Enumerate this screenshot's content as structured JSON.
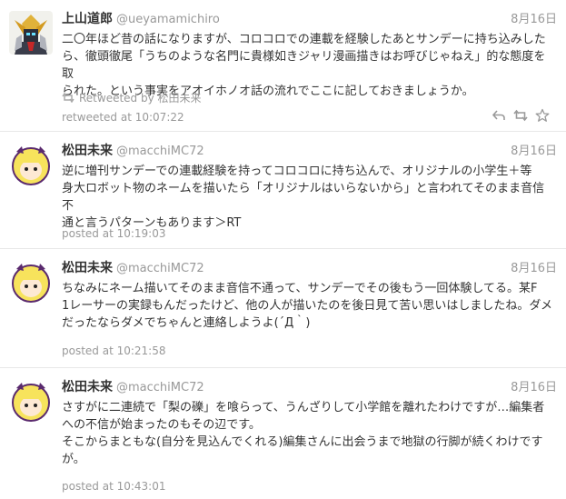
{
  "tweets": [
    {
      "name": "上山道郎",
      "screen_name": "@ueyamamichiro",
      "date": "8月16日",
      "text_lines": [
        "二〇年ほど昔の話になりますが、コロコロでの連載を経験したあとサンデーに持ち込みした",
        "ら、徹頭徹尾「うちのような名門に貴様如きジャリ漫画描きはお呼びじゃねえ」的な態度を取",
        "られた。という事実をアオイホノオ話の流れでここに記しておきましょうか。"
      ],
      "retweet_label": "Retweeted by",
      "retweeted_by": "松田未来",
      "stamp": "retweeted at 10:07:22"
    },
    {
      "name": "松田未来",
      "screen_name": "@macchiMC72",
      "date": "8月16日",
      "text_lines": [
        "逆に増刊サンデーでの連載経験を持ってコロコロに持ち込んで、オリジナルの小学生＋等",
        "身大ロボット物のネームを描いたら「オリジナルはいらないから」と言われてそのまま音信不",
        "通と言うパターンもあります＞RT"
      ],
      "stamp": "posted at 10:19:03"
    },
    {
      "name": "松田未来",
      "screen_name": "@macchiMC72",
      "date": "8月16日",
      "text_lines": [
        "ちなみにネーム描いてそのまま音信不通って、サンデーでその後もう一回体験してる。某F",
        "1レーサーの実録もんだったけど、他の人が描いたのを後日見て苦い思いはしましたね。ダメ",
        "だったならダメでちゃんと連絡しようよ(´Д｀)"
      ],
      "stamp": "posted at 10:21:58"
    },
    {
      "name": "松田未来",
      "screen_name": "@macchiMC72",
      "date": "8月16日",
      "text_lines": [
        "さすがに二連続で「梨の礫」を喰らって、うんざりして小学館を離れたわけですが…編集者",
        "への不信が始まったのもその辺です。",
        "そこからまともな(自分を見込んでくれる)編集さんに出会うまで地獄の行脚が続くわけです",
        "が。"
      ],
      "stamp": "posted at 10:43:01"
    }
  ],
  "icons": {
    "reply": "reply-icon",
    "retweet": "retweet-icon",
    "favorite": "star-icon"
  },
  "colors": {
    "meta": "#999999",
    "text": "#333333",
    "divider": "#e8e8e8"
  }
}
